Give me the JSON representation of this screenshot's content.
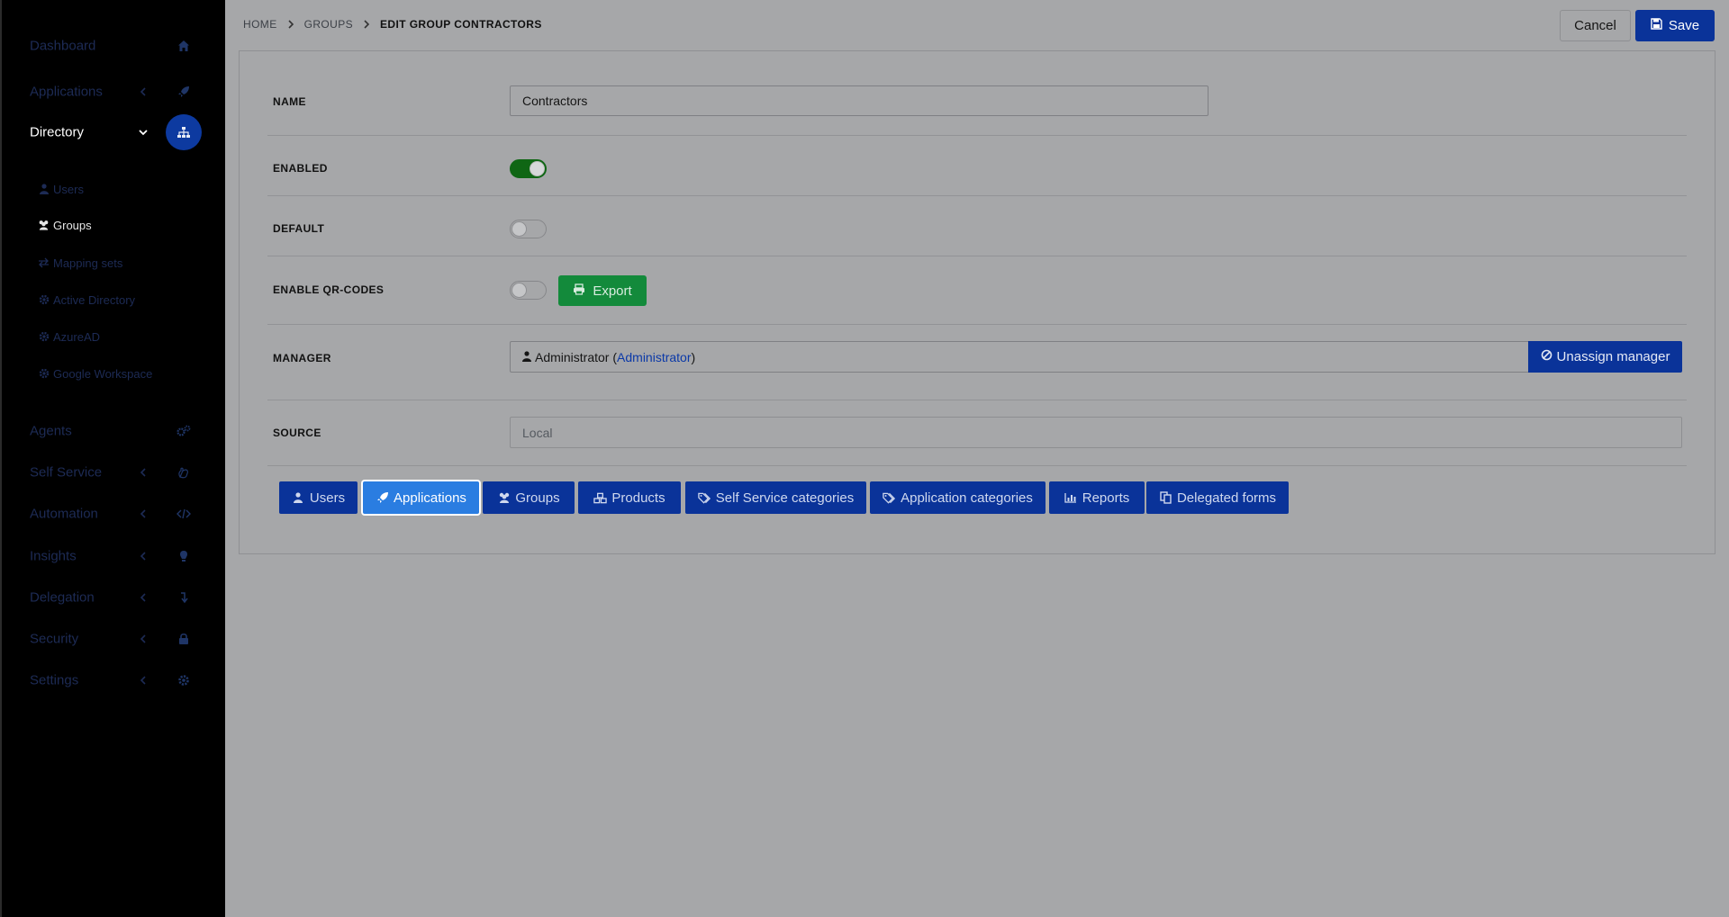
{
  "sidebar": {
    "items": [
      {
        "label": "Dashboard",
        "icon": "home-icon"
      },
      {
        "label": "Applications",
        "icon": "rocket-icon"
      },
      {
        "label": "Directory",
        "icon": "sitemap-icon"
      },
      {
        "label": "Agents",
        "icon": "cogs-icon"
      },
      {
        "label": "Self Service",
        "icon": "hand-icon"
      },
      {
        "label": "Automation",
        "icon": "code-icon"
      },
      {
        "label": "Insights",
        "icon": "lightbulb-icon"
      },
      {
        "label": "Delegation",
        "icon": "level-down-icon"
      },
      {
        "label": "Security",
        "icon": "lock-icon"
      },
      {
        "label": "Settings",
        "icon": "gear-icon"
      }
    ],
    "directory_sub": [
      {
        "label": "Users",
        "icon": "user-icon"
      },
      {
        "label": "Groups",
        "icon": "users-icon"
      },
      {
        "label": "Mapping sets",
        "icon": "exchange-icon"
      },
      {
        "label": "Active Directory",
        "icon": "cog-icon"
      },
      {
        "label": "AzureAD",
        "icon": "cog-icon"
      },
      {
        "label": "Google Workspace",
        "icon": "cog-icon"
      }
    ]
  },
  "breadcrumb": {
    "home": "HOME",
    "groups": "GROUPS",
    "current": "EDIT GROUP CONTRACTORS"
  },
  "toolbar": {
    "cancel_label": "Cancel",
    "save_label": "Save"
  },
  "form": {
    "name_label": "NAME",
    "name_value": "Contractors",
    "enabled_label": "ENABLED",
    "enabled": true,
    "default_label": "DEFAULT",
    "default": false,
    "qr_label": "ENABLE QR-CODES",
    "qr_enabled": false,
    "export_label": "Export",
    "manager_label": "MANAGER",
    "manager_name": "Administrator (",
    "manager_link": "Administrator",
    "manager_close": ")",
    "unassign_label": "Unassign manager",
    "source_label": "SOURCE",
    "source_placeholder": "Local"
  },
  "tabs": [
    {
      "label": "Users",
      "icon": "user-icon"
    },
    {
      "label": "Applications",
      "icon": "rocket-icon",
      "selected": true
    },
    {
      "label": "Groups",
      "icon": "users-icon"
    },
    {
      "label": "Products",
      "icon": "cubes-icon"
    },
    {
      "label": "Self Service categories",
      "icon": "tags-icon"
    },
    {
      "label": "Application categories",
      "icon": "tags-icon"
    },
    {
      "label": "Reports",
      "icon": "bar-chart-icon"
    },
    {
      "label": "Delegated forms",
      "icon": "copy-icon"
    }
  ],
  "colors": {
    "primary": "#0a3399",
    "selected_tab": "#2a7de1",
    "success": "#138a3b",
    "toggle_on": "#0f6614",
    "sidebar_bg": "#000000",
    "page_bg": "#a6a7a9"
  }
}
